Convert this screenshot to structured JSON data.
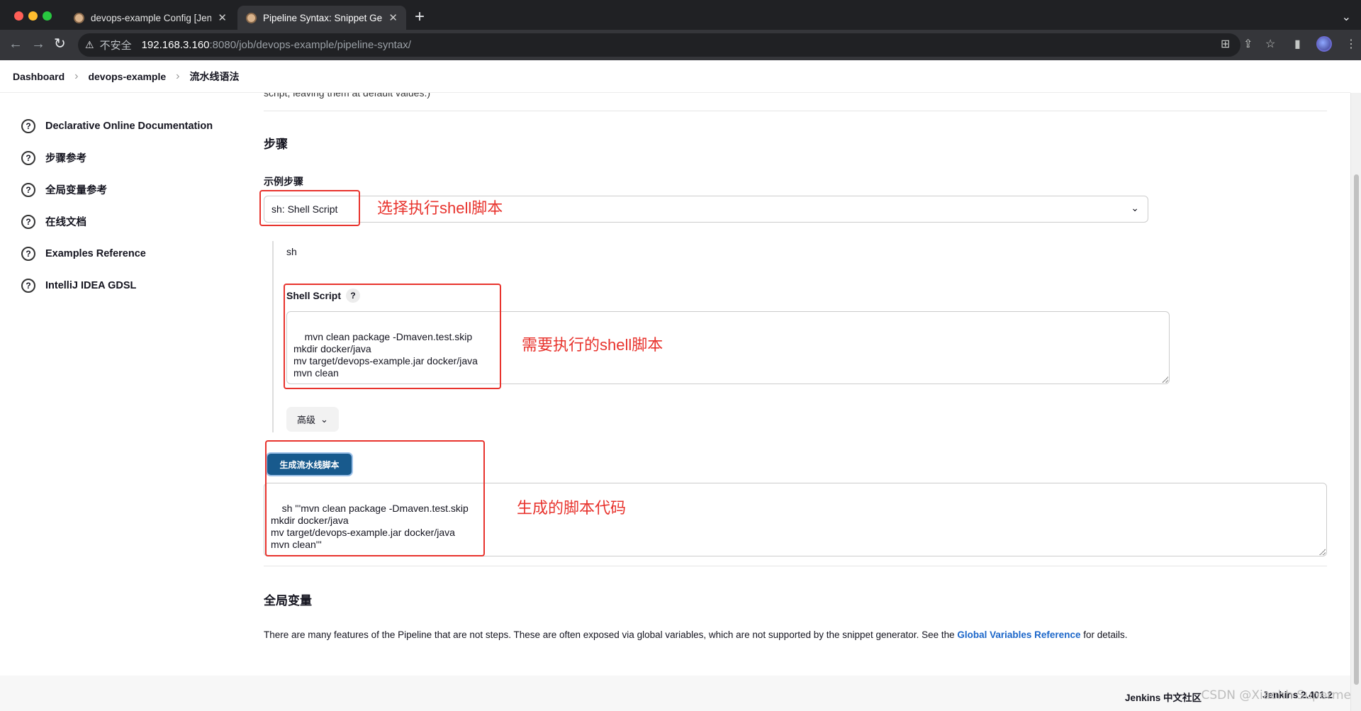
{
  "browser": {
    "tabs": [
      {
        "title": "devops-example Config [Jenkins]",
        "active": false
      },
      {
        "title": "Pipeline Syntax: Snippet Generator",
        "active": true
      }
    ],
    "new_tab": "+",
    "tabs_menu": "⌄",
    "nav": {
      "back": "←",
      "forward": "→",
      "reload": "↻"
    },
    "address": {
      "warning": "⚠",
      "security_label": "不安全",
      "host": "192.168.3.160",
      "path": ":8080/job/devops-example/pipeline-syntax/"
    },
    "toolbar_icons": {
      "translate": "⊞",
      "share": "⇪",
      "bookmark": "☆",
      "sidebar": "▮",
      "menu": "⋮"
    }
  },
  "breadcrumb": [
    {
      "label": "Dashboard"
    },
    {
      "label": "devops-example"
    },
    {
      "label": "流水线语法"
    }
  ],
  "breadcrumb_separator": "›",
  "sidebar": {
    "items": [
      {
        "label": "Declarative Online Documentation",
        "icon": "?"
      },
      {
        "label": "步骤参考",
        "icon": "?"
      },
      {
        "label": "全局变量参考",
        "icon": "?"
      },
      {
        "label": "在线文档",
        "icon": "?"
      },
      {
        "label": "Examples Reference",
        "icon": "?"
      },
      {
        "label": "IntelliJ IDEA GDSL",
        "icon": "?"
      }
    ]
  },
  "main": {
    "cut_text": "script, leaving them at default values.)",
    "steps_heading": "步骤",
    "sample_step_label": "示例步骤",
    "sample_step_value": "sh: Shell Script",
    "select_chevron": "⌄",
    "step_name": "sh",
    "shell_script_label": "Shell Script",
    "help": "?",
    "shell_script_value": "mvn clean package -Dmaven.test.skip\nmkdir docker/java\nmv target/devops-example.jar docker/java\nmvn clean",
    "advanced_label": "高级",
    "advanced_chevron": "⌄",
    "generate_button": "生成流水线脚本",
    "generated_script": "sh '''mvn clean package -Dmaven.test.skip\nmkdir docker/java\nmv target/devops-example.jar docker/java\nmvn clean'''",
    "global_vars_heading": "全局变量",
    "global_vars_text_before": "There are many features of the Pipeline that are not steps. These are often exposed via global variables, which are not supported by the snippet generator. See the ",
    "global_vars_link": "Global Variables Reference",
    "global_vars_text_after": " for details."
  },
  "annotations": {
    "select_note": "选择执行shell脚本",
    "script_note": "需要执行的shell脚本",
    "generated_note": "生成的脚本代码"
  },
  "footer": {
    "community": "Jenkins 中文社区",
    "version": "Jenkins 2.401.2"
  },
  "watermark": "CSDN @Xiaohh Superme"
}
